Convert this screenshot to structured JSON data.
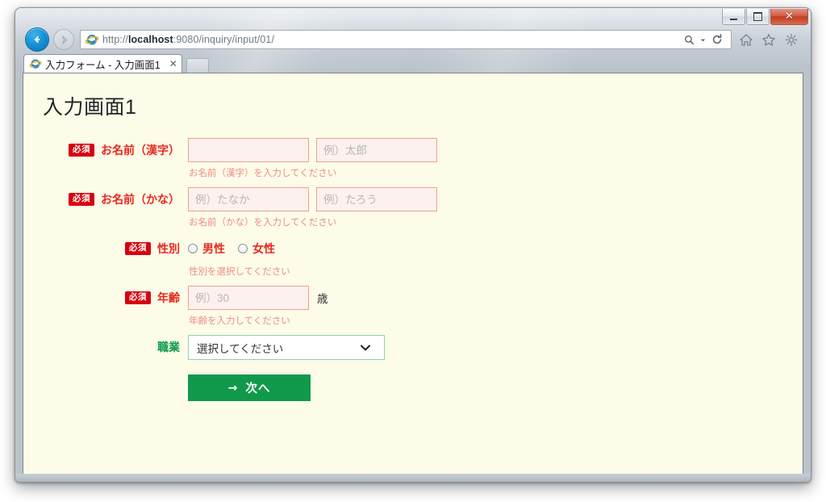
{
  "window": {
    "controls": {
      "minimize_label": "–",
      "maximize_label": "❐",
      "close_label": "✕"
    }
  },
  "browser": {
    "address": {
      "url_prefix": "http://",
      "url_host": "localhost",
      "url_rest": ":9080/inquiry/input/01/",
      "full_url": "http://localhost:9080/inquiry/input/01/",
      "search_icon": "search-icon",
      "search_dropdown_icon": "chevron-down-icon",
      "refresh_icon": "refresh-icon"
    },
    "nav": {
      "back_icon": "back-arrow-icon",
      "forward_icon": "forward-arrow-icon"
    },
    "toolbar_icons": [
      {
        "name": "home-icon"
      },
      {
        "name": "favorites-star-icon"
      },
      {
        "name": "settings-gear-icon"
      }
    ],
    "tab": {
      "title": "入力フォーム - 入力画面1",
      "close_label": "✕",
      "favicon": "internet-explorer-icon"
    }
  },
  "page": {
    "title": "入力画面1",
    "required_badge": "必須",
    "rows": [
      {
        "id": "name-kanji",
        "required": true,
        "label": "お名前（漢字）",
        "input1_value": "",
        "input1_placeholder": "",
        "input2_value": "",
        "input2_placeholder": "例）太郎",
        "help": "お名前（漢字）を入力してください"
      },
      {
        "id": "name-kana",
        "required": true,
        "label": "お名前（かな）",
        "input1_value": "",
        "input1_placeholder": "例）たなか",
        "input2_value": "",
        "input2_placeholder": "例）たろう",
        "help": "お名前（かな）を入力してください"
      },
      {
        "id": "gender",
        "required": true,
        "label": "性別",
        "options": [
          {
            "label": "男性",
            "selected": false
          },
          {
            "label": "女性",
            "selected": false
          }
        ],
        "help": "性別を選択してください"
      },
      {
        "id": "age",
        "required": true,
        "label": "年齢",
        "input1_value": "",
        "input1_placeholder": "例）30",
        "unit": "歳",
        "help": "年齢を入力してください"
      },
      {
        "id": "occupation",
        "required": false,
        "label": "職業",
        "select_value": "選択してください",
        "chevron_icon": "chevron-down-icon"
      }
    ],
    "submit": {
      "arrow": "→",
      "label": "次へ"
    }
  },
  "colors": {
    "page_background": "#fcfce9",
    "required_badge_bg": "#d7000f",
    "required_label": "#e8291e",
    "optional_label": "#0f9a4e",
    "input_border": "#ef9f92",
    "input_background": "#fdf1ef",
    "help_text": "#ef8d80",
    "select_border": "#8ed2a8",
    "submit_button_bg": "#11994b",
    "close_button_bg": "#bf3d22"
  }
}
